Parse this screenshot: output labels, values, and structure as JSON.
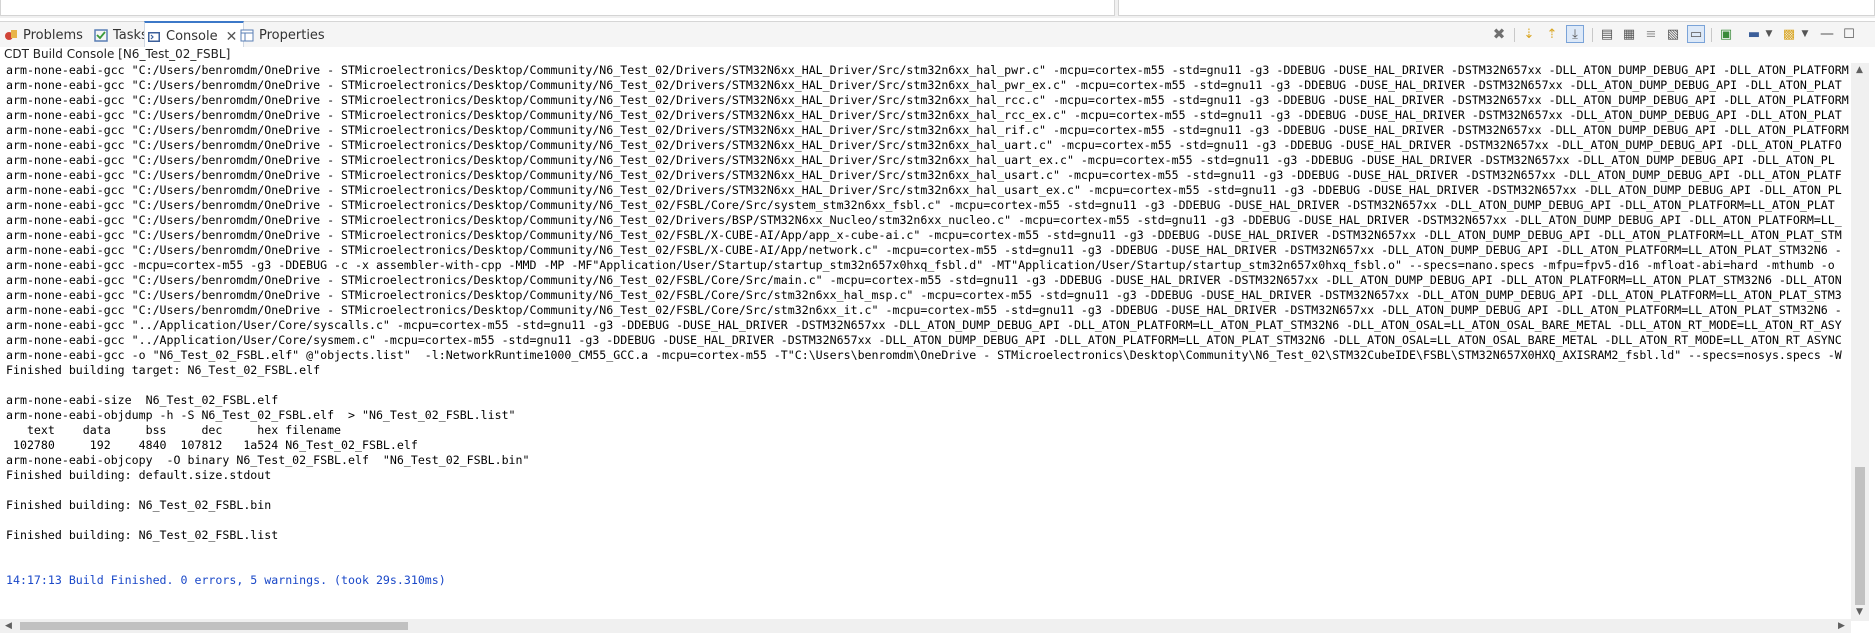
{
  "tabs": [
    {
      "label": "Problems"
    },
    {
      "label": "Tasks"
    },
    {
      "label": "Console",
      "active": true
    },
    {
      "label": "Properties"
    }
  ],
  "console_title": "CDT Build Console [N6_Test_02_FSBL]",
  "console_lines": [
    {
      "text": "arm-none-eabi-gcc \"C:/Users/benromdm/OneDrive - STMicroelectronics/Desktop/Community/N6_Test_02/Drivers/STM32N6xx_HAL_Driver/Src/stm32n6xx_hal_pwr.c\" -mcpu=cortex-m55 -std=gnu11 -g3 -DDEBUG -DUSE_HAL_DRIVER -DSTM32N657xx -DLL_ATON_DUMP_DEBUG_API -DLL_ATON_PLATFORM"
    },
    {
      "text": "arm-none-eabi-gcc \"C:/Users/benromdm/OneDrive - STMicroelectronics/Desktop/Community/N6_Test_02/Drivers/STM32N6xx_HAL_Driver/Src/stm32n6xx_hal_pwr_ex.c\" -mcpu=cortex-m55 -std=gnu11 -g3 -DDEBUG -DUSE_HAL_DRIVER -DSTM32N657xx -DLL_ATON_DUMP_DEBUG_API -DLL_ATON_PLAT"
    },
    {
      "text": "arm-none-eabi-gcc \"C:/Users/benromdm/OneDrive - STMicroelectronics/Desktop/Community/N6_Test_02/Drivers/STM32N6xx_HAL_Driver/Src/stm32n6xx_hal_rcc.c\" -mcpu=cortex-m55 -std=gnu11 -g3 -DDEBUG -DUSE_HAL_DRIVER -DSTM32N657xx -DLL_ATON_DUMP_DEBUG_API -DLL_ATON_PLATFORM"
    },
    {
      "text": "arm-none-eabi-gcc \"C:/Users/benromdm/OneDrive - STMicroelectronics/Desktop/Community/N6_Test_02/Drivers/STM32N6xx_HAL_Driver/Src/stm32n6xx_hal_rcc_ex.c\" -mcpu=cortex-m55 -std=gnu11 -g3 -DDEBUG -DUSE_HAL_DRIVER -DSTM32N657xx -DLL_ATON_DUMP_DEBUG_API -DLL_ATON_PLAT"
    },
    {
      "text": "arm-none-eabi-gcc \"C:/Users/benromdm/OneDrive - STMicroelectronics/Desktop/Community/N6_Test_02/Drivers/STM32N6xx_HAL_Driver/Src/stm32n6xx_hal_rif.c\" -mcpu=cortex-m55 -std=gnu11 -g3 -DDEBUG -DUSE_HAL_DRIVER -DSTM32N657xx -DLL_ATON_DUMP_DEBUG_API -DLL_ATON_PLATFORM"
    },
    {
      "text": "arm-none-eabi-gcc \"C:/Users/benromdm/OneDrive - STMicroelectronics/Desktop/Community/N6_Test_02/Drivers/STM32N6xx_HAL_Driver/Src/stm32n6xx_hal_uart.c\" -mcpu=cortex-m55 -std=gnu11 -g3 -DDEBUG -DUSE_HAL_DRIVER -DSTM32N657xx -DLL_ATON_DUMP_DEBUG_API -DLL_ATON_PLATFO"
    },
    {
      "text": "arm-none-eabi-gcc \"C:/Users/benromdm/OneDrive - STMicroelectronics/Desktop/Community/N6_Test_02/Drivers/STM32N6xx_HAL_Driver/Src/stm32n6xx_hal_uart_ex.c\" -mcpu=cortex-m55 -std=gnu11 -g3 -DDEBUG -DUSE_HAL_DRIVER -DSTM32N657xx -DLL_ATON_DUMP_DEBUG_API -DLL_ATON_PL"
    },
    {
      "text": "arm-none-eabi-gcc \"C:/Users/benromdm/OneDrive - STMicroelectronics/Desktop/Community/N6_Test_02/Drivers/STM32N6xx_HAL_Driver/Src/stm32n6xx_hal_usart.c\" -mcpu=cortex-m55 -std=gnu11 -g3 -DDEBUG -DUSE_HAL_DRIVER -DSTM32N657xx -DLL_ATON_DUMP_DEBUG_API -DLL_ATON_PLATF"
    },
    {
      "text": "arm-none-eabi-gcc \"C:/Users/benromdm/OneDrive - STMicroelectronics/Desktop/Community/N6_Test_02/Drivers/STM32N6xx_HAL_Driver/Src/stm32n6xx_hal_usart_ex.c\" -mcpu=cortex-m55 -std=gnu11 -g3 -DDEBUG -DUSE_HAL_DRIVER -DSTM32N657xx -DLL_ATON_DUMP_DEBUG_API -DLL_ATON_PL"
    },
    {
      "text": "arm-none-eabi-gcc \"C:/Users/benromdm/OneDrive - STMicroelectronics/Desktop/Community/N6_Test_02/FSBL/Core/Src/system_stm32n6xx_fsbl.c\" -mcpu=cortex-m55 -std=gnu11 -g3 -DDEBUG -DUSE_HAL_DRIVER -DSTM32N657xx -DLL_ATON_DUMP_DEBUG_API -DLL_ATON_PLATFORM=LL_ATON_PLAT"
    },
    {
      "text": "arm-none-eabi-gcc \"C:/Users/benromdm/OneDrive - STMicroelectronics/Desktop/Community/N6_Test_02/Drivers/BSP/STM32N6xx_Nucleo/stm32n6xx_nucleo.c\" -mcpu=cortex-m55 -std=gnu11 -g3 -DDEBUG -DUSE_HAL_DRIVER -DSTM32N657xx -DLL_ATON_DUMP_DEBUG_API -DLL_ATON_PLATFORM=LL_"
    },
    {
      "text": "arm-none-eabi-gcc \"C:/Users/benromdm/OneDrive - STMicroelectronics/Desktop/Community/N6_Test_02/FSBL/X-CUBE-AI/App/app_x-cube-ai.c\" -mcpu=cortex-m55 -std=gnu11 -g3 -DDEBUG -DUSE_HAL_DRIVER -DSTM32N657xx -DLL_ATON_DUMP_DEBUG_API -DLL_ATON_PLATFORM=LL_ATON_PLAT_STM"
    },
    {
      "text": "arm-none-eabi-gcc \"C:/Users/benromdm/OneDrive - STMicroelectronics/Desktop/Community/N6_Test_02/FSBL/X-CUBE-AI/App/network.c\" -mcpu=cortex-m55 -std=gnu11 -g3 -DDEBUG -DUSE_HAL_DRIVER -DSTM32N657xx -DLL_ATON_DUMP_DEBUG_API -DLL_ATON_PLATFORM=LL_ATON_PLAT_STM32N6 -"
    },
    {
      "text": "arm-none-eabi-gcc -mcpu=cortex-m55 -g3 -DDEBUG -c -x assembler-with-cpp -MMD -MP -MF\"Application/User/Startup/startup_stm32n657x0hxq_fsbl.d\" -MT\"Application/User/Startup/startup_stm32n657x0hxq_fsbl.o\" --specs=nano.specs -mfpu=fpv5-d16 -mfloat-abi=hard -mthumb -o"
    },
    {
      "text": "arm-none-eabi-gcc \"C:/Users/benromdm/OneDrive - STMicroelectronics/Desktop/Community/N6_Test_02/FSBL/Core/Src/main.c\" -mcpu=cortex-m55 -std=gnu11 -g3 -DDEBUG -DUSE_HAL_DRIVER -DSTM32N657xx -DLL_ATON_DUMP_DEBUG_API -DLL_ATON_PLATFORM=LL_ATON_PLAT_STM32N6 -DLL_ATON"
    },
    {
      "text": "arm-none-eabi-gcc \"C:/Users/benromdm/OneDrive - STMicroelectronics/Desktop/Community/N6_Test_02/FSBL/Core/Src/stm32n6xx_hal_msp.c\" -mcpu=cortex-m55 -std=gnu11 -g3 -DDEBUG -DUSE_HAL_DRIVER -DSTM32N657xx -DLL_ATON_DUMP_DEBUG_API -DLL_ATON_PLATFORM=LL_ATON_PLAT_STM3"
    },
    {
      "text": "arm-none-eabi-gcc \"C:/Users/benromdm/OneDrive - STMicroelectronics/Desktop/Community/N6_Test_02/FSBL/Core/Src/stm32n6xx_it.c\" -mcpu=cortex-m55 -std=gnu11 -g3 -DDEBUG -DUSE_HAL_DRIVER -DSTM32N657xx -DLL_ATON_DUMP_DEBUG_API -DLL_ATON_PLATFORM=LL_ATON_PLAT_STM32N6 -"
    },
    {
      "text": "arm-none-eabi-gcc \"../Application/User/Core/syscalls.c\" -mcpu=cortex-m55 -std=gnu11 -g3 -DDEBUG -DUSE_HAL_DRIVER -DSTM32N657xx -DLL_ATON_DUMP_DEBUG_API -DLL_ATON_PLATFORM=LL_ATON_PLAT_STM32N6 -DLL_ATON_OSAL=LL_ATON_OSAL_BARE_METAL -DLL_ATON_RT_MODE=LL_ATON_RT_ASY"
    },
    {
      "text": "arm-none-eabi-gcc \"../Application/User/Core/sysmem.c\" -mcpu=cortex-m55 -std=gnu11 -g3 -DDEBUG -DUSE_HAL_DRIVER -DSTM32N657xx -DLL_ATON_DUMP_DEBUG_API -DLL_ATON_PLATFORM=LL_ATON_PLAT_STM32N6 -DLL_ATON_OSAL=LL_ATON_OSAL_BARE_METAL -DLL_ATON_RT_MODE=LL_ATON_RT_ASYNC"
    },
    {
      "text": "arm-none-eabi-gcc -o \"N6_Test_02_FSBL.elf\" @\"objects.list\"  -l:NetworkRuntime1000_CM55_GCC.a -mcpu=cortex-m55 -T\"C:\\Users\\benromdm\\OneDrive - STMicroelectronics\\Desktop\\Community\\N6_Test_02\\STM32CubeIDE\\FSBL\\STM32N657X0HXQ_AXISRAM2_fsbl.ld\" --specs=nosys.specs -W"
    },
    {
      "text": "Finished building target: N6_Test_02_FSBL.elf"
    },
    {
      "text": ""
    },
    {
      "text": "arm-none-eabi-size  N6_Test_02_FSBL.elf"
    },
    {
      "text": "arm-none-eabi-objdump -h -S N6_Test_02_FSBL.elf  > \"N6_Test_02_FSBL.list\""
    },
    {
      "text": "   text    data     bss     dec     hex filename"
    },
    {
      "text": " 102780     192    4840  107812   1a524 N6_Test_02_FSBL.elf"
    },
    {
      "text": "arm-none-eabi-objcopy  -O binary N6_Test_02_FSBL.elf  \"N6_Test_02_FSBL.bin\""
    },
    {
      "text": "Finished building: default.size.stdout"
    },
    {
      "text": ""
    },
    {
      "text": "Finished building: N6_Test_02_FSBL.bin"
    },
    {
      "text": ""
    },
    {
      "text": "Finished building: N6_Test_02_FSBL.list"
    },
    {
      "text": ""
    },
    {
      "text": ""
    },
    {
      "text": "14:17:13 Build Finished. 0 errors, 5 warnings. (took 29s.310ms)",
      "style": "blue"
    }
  ],
  "toolbar_icons": [
    "terminate-icon",
    "scroll-next-icon",
    "scroll-prev-icon",
    "scroll-lock-icon",
    "show-console-icon",
    "word-wrap-icon",
    "pin-icon",
    "clear-console-icon",
    "display-selected-icon",
    "open-console-icon",
    "new-console-icon",
    "view-menu-icon",
    "minimize-icon",
    "maximize-icon"
  ],
  "colors": {
    "accent": "#3c78c8",
    "info_text": "#1a48c8",
    "tab_bar": "#f5f5f5"
  }
}
